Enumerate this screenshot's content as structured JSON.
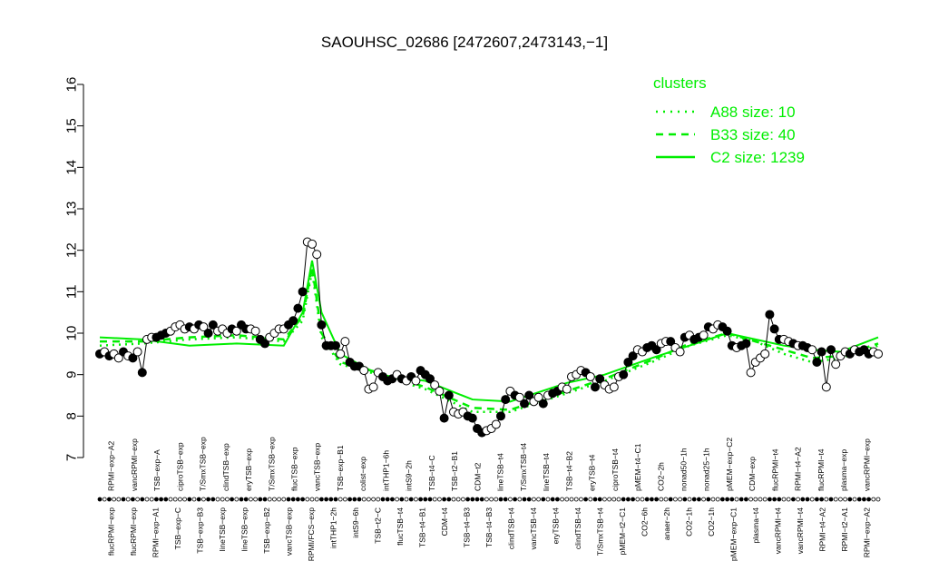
{
  "chart_data": {
    "type": "line",
    "title": "SAOUHSC_02686 [2472607,2473143,−1]",
    "xlabel": "",
    "ylabel": "",
    "ylim": [
      7,
      16
    ],
    "yticks": [
      7,
      8,
      9,
      10,
      11,
      12,
      13,
      14,
      15,
      16
    ],
    "grid": false,
    "legend": {
      "title": "clusters",
      "position": "top-right",
      "entries": [
        {
          "label": "A88 size: 10",
          "style": "dotted"
        },
        {
          "label": "B33 size: 40",
          "style": "dashed"
        },
        {
          "label": "C2 size: 1239",
          "style": "solid"
        }
      ]
    },
    "colors": {
      "series": "#00ee00",
      "line": "#000000",
      "filled": "#000000",
      "open": "#ffffff"
    },
    "x_labels_top": [
      "RPMI−exp−A2",
      "vancRPMI−exp",
      "TSB−exp−A",
      "ciproTSB−exp",
      "T/SmxTSB−exp",
      "clindTSB−exp",
      "eryTSB−exp",
      "T/SmxTSB−exp",
      "flucTSB−exp",
      "vancTSB−exp",
      "TSB−exp−B1",
      "colist−exp",
      "intTHP1−6h",
      "intS9−2h",
      "TSB−t4−C",
      "TSB−t2−B1",
      "CDM−t2",
      "lineTSB−t4",
      "T/SmxTSB−t4",
      "lineTSB−t4",
      "TSB−t4−B2",
      "eryTSB−t4",
      "ciproTSB−t4",
      "pMEM−t4−C1",
      "CO2−2h",
      "nonad50−1h",
      "nonad25−1h",
      "pMEM−exp−C2",
      "CDM−exp",
      "flucRPMI−t4",
      "RPMI−t4−A2",
      "flucRPMI−t4",
      "plasma−exp",
      "vancRPMI−exp"
    ],
    "x_labels_bottom": [
      "flucRPMI−exp",
      "flucRPMI−exp",
      "RPMI−exp−A1",
      "TSB−exp−C",
      "TSB−exp−B3",
      "lineTSB−exp",
      "lineTSB−exp",
      "TSB−exp−B2",
      "vancTSB−exp",
      "RPMI/FCS−exp",
      "intTHP1−2h",
      "intS9−6h",
      "TSB−t2−C",
      "flucTSB−t4",
      "TSB−t4−B1",
      "CDM−t4",
      "TSB−t4−B3",
      "TSB−t4−B3",
      "clindTSB−t4",
      "vancTSB−t4",
      "eryTSB−t4",
      "clindTSB−t4",
      "T/SmxTSB−t4",
      "pMEM−t2−C1",
      "CO2−6h",
      "anaer−2h",
      "CO2−1h",
      "CO2−1h",
      "pMEM−exp−C1",
      "plasma−t4",
      "vancRPMI−t4",
      "vancRPMI−t4",
      "RPMI−t4−A2",
      "RPMI−t2−A1",
      "RPMI−exp−A2"
    ],
    "series": [
      {
        "x": [
          1,
          2,
          3,
          4,
          5,
          6,
          7,
          8,
          9,
          10,
          11,
          12,
          13,
          14,
          15,
          16,
          17,
          18,
          19,
          20,
          21,
          22,
          23,
          24,
          25,
          26,
          27,
          28,
          29,
          30,
          31,
          32,
          33,
          34,
          35,
          36,
          37,
          38,
          39,
          40,
          41,
          42,
          43,
          44,
          45,
          46,
          47,
          48,
          49,
          50,
          51,
          52,
          53,
          54,
          55,
          56,
          57,
          58,
          59,
          60,
          61,
          62,
          63,
          64,
          65,
          66,
          67,
          68,
          69,
          70,
          71,
          72,
          73,
          74,
          75,
          76,
          77,
          78,
          79,
          80,
          81,
          82,
          83,
          84,
          85,
          86,
          87,
          88,
          89,
          90,
          91,
          92,
          93,
          94,
          95,
          96,
          97,
          98,
          99,
          100,
          101,
          102,
          103,
          104,
          105,
          106,
          107,
          108,
          109,
          110,
          111,
          112,
          113,
          114,
          115,
          116,
          117,
          118,
          119,
          120,
          121,
          122,
          123,
          124,
          125,
          126,
          127,
          128,
          129,
          130,
          131,
          132,
          133,
          134,
          135,
          136,
          137,
          138,
          139,
          140,
          141,
          142,
          143,
          144,
          145,
          146,
          147,
          148,
          149,
          150,
          151,
          152,
          153,
          154,
          155,
          156,
          157,
          158,
          159,
          160,
          161,
          162,
          163,
          164,
          165,
          166
        ],
        "y": [
          9.5,
          9.55,
          9.45,
          9.5,
          9.4,
          9.55,
          9.45,
          9.4,
          9.55,
          9.05,
          9.85,
          9.9,
          9.9,
          9.95,
          10.0,
          10.05,
          10.15,
          10.2,
          10.1,
          10.15,
          10.1,
          10.2,
          10.15,
          10.0,
          10.2,
          10.05,
          10.1,
          10.0,
          10.1,
          10.05,
          10.2,
          10.1,
          10.1,
          10.05,
          9.85,
          9.75,
          9.9,
          10.0,
          10.1,
          10.1,
          10.2,
          10.3,
          10.6,
          11.0,
          12.2,
          12.15,
          11.9,
          10.2,
          9.7,
          9.7,
          9.7,
          9.5,
          9.8,
          9.3,
          9.2,
          9.2,
          9.1,
          8.65,
          8.7,
          9.05,
          8.95,
          8.85,
          8.9,
          9.0,
          8.9,
          8.85,
          8.95,
          8.85,
          9.1,
          9.0,
          8.9,
          8.75,
          8.6,
          7.95,
          8.5,
          8.1,
          8.05,
          8.1,
          8.0,
          7.95,
          7.7,
          7.6,
          7.65,
          7.7,
          7.8,
          8.0,
          8.4,
          8.6,
          8.5,
          8.45,
          8.3,
          8.5,
          8.35,
          8.45,
          8.3,
          8.5,
          8.55,
          8.6,
          8.7,
          8.65,
          8.95,
          9.0,
          9.1,
          9.05,
          8.95,
          8.7,
          8.9,
          8.75,
          8.65,
          8.7,
          8.95,
          9.0,
          9.3,
          9.45,
          9.6,
          9.55,
          9.65,
          9.7,
          9.6,
          9.75,
          9.8,
          9.8,
          9.65,
          9.55,
          9.9,
          9.95,
          9.85,
          9.9,
          9.95,
          10.15,
          10.1,
          10.2,
          10.15,
          10.05,
          9.7,
          9.65,
          9.7,
          9.75,
          9.05,
          9.3,
          9.4,
          9.5,
          10.45,
          10.1,
          9.85,
          9.85,
          9.8,
          9.75,
          9.7,
          9.7,
          9.65,
          9.6,
          9.3,
          9.55,
          8.7,
          9.6,
          9.25,
          9.45,
          9.55,
          9.5,
          9.6,
          9.55,
          9.6,
          9.5,
          9.55,
          9.5
        ],
        "filled": [
          1,
          0,
          1,
          0,
          0,
          1,
          0,
          1,
          0,
          1,
          0,
          0,
          1,
          1,
          1,
          0,
          0,
          0,
          0,
          1,
          0,
          1,
          0,
          1,
          1,
          0,
          0,
          0,
          1,
          0,
          1,
          1,
          0,
          0,
          1,
          1,
          0,
          0,
          0,
          0,
          1,
          1,
          1,
          1,
          0,
          0,
          0,
          1,
          1,
          1,
          1,
          0,
          0,
          1,
          1,
          1,
          0,
          0,
          0,
          0,
          1,
          1,
          1,
          0,
          1,
          0,
          1,
          0,
          1,
          1,
          1,
          0,
          0,
          1,
          1,
          0,
          0,
          0,
          1,
          1,
          1,
          1,
          0,
          0,
          0,
          1,
          1,
          0,
          1,
          0,
          1,
          1,
          0,
          0,
          1,
          0,
          1,
          1,
          0,
          0,
          0,
          0,
          0,
          1,
          0,
          1,
          1,
          0,
          0,
          0,
          0,
          1,
          1,
          1,
          0,
          0,
          1,
          1,
          1,
          0,
          0,
          1,
          0,
          0,
          1,
          0,
          1,
          1,
          0,
          1,
          0,
          0,
          1,
          1,
          1,
          0,
          1,
          1,
          0,
          0,
          0,
          0,
          1,
          1,
          1,
          0,
          0,
          1,
          0,
          1,
          1,
          0,
          1,
          1,
          0,
          1,
          0,
          0,
          0,
          1,
          0,
          1,
          1,
          1,
          0,
          0,
          1,
          1
        ]
      },
      {
        "name": "C2 size: 1239",
        "style": "solid",
        "x": [
          1,
          10,
          20,
          30,
          40,
          44,
          46,
          48,
          52,
          60,
          70,
          80,
          88,
          100,
          108,
          118,
          126,
          134,
          140,
          146,
          152,
          158,
          166
        ],
        "y": [
          9.9,
          9.85,
          9.7,
          9.75,
          9.7,
          10.5,
          11.75,
          10.5,
          9.5,
          9.0,
          8.85,
          8.4,
          8.35,
          8.8,
          9.0,
          9.4,
          9.7,
          10.0,
          9.85,
          9.7,
          9.6,
          9.55,
          9.9
        ]
      },
      {
        "name": "B33 size: 40",
        "style": "dashed",
        "x": [
          1,
          10,
          20,
          30,
          40,
          44,
          46,
          48,
          52,
          60,
          70,
          80,
          88,
          100,
          108,
          118,
          126,
          134,
          140,
          146,
          152,
          158,
          166
        ],
        "y": [
          9.8,
          9.8,
          9.9,
          9.95,
          9.85,
          10.4,
          11.6,
          10.0,
          9.3,
          9.05,
          8.7,
          8.2,
          8.15,
          8.6,
          8.9,
          9.35,
          9.75,
          10.0,
          9.8,
          9.6,
          9.4,
          9.45,
          9.75
        ]
      },
      {
        "name": "A88 size: 10",
        "style": "dotted",
        "x": [
          1,
          10,
          20,
          30,
          40,
          44,
          46,
          48,
          52,
          60,
          70,
          80,
          88,
          100,
          108,
          118,
          126,
          134,
          140,
          146,
          152,
          158,
          166
        ],
        "y": [
          9.7,
          9.75,
          9.85,
          9.9,
          9.8,
          10.3,
          11.5,
          9.9,
          9.25,
          9.0,
          8.65,
          8.1,
          8.1,
          8.55,
          8.85,
          9.3,
          9.7,
          9.95,
          9.8,
          9.5,
          9.3,
          9.4,
          9.7
        ]
      }
    ]
  }
}
